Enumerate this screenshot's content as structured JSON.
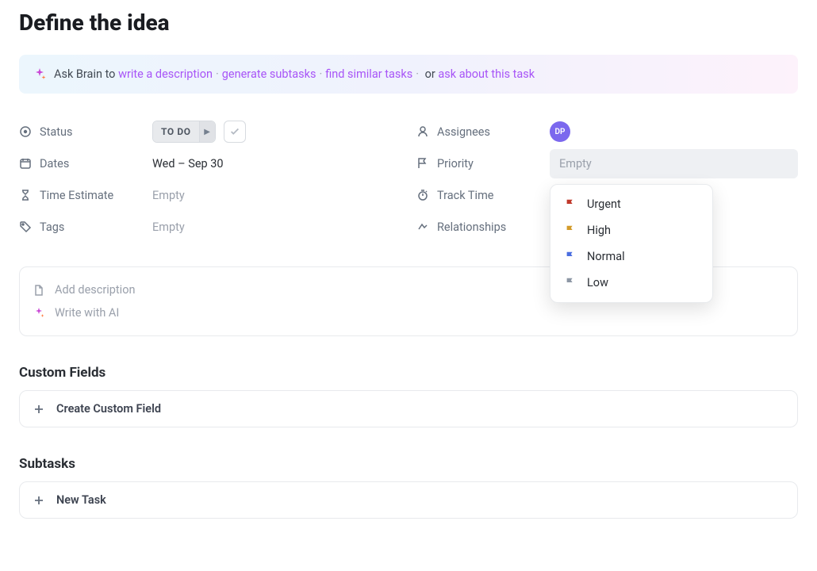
{
  "title": "Define the idea",
  "ai_banner": {
    "lead": "Ask Brain to",
    "write_description": "write a description",
    "generate_subtasks": "generate subtasks",
    "find_similar": "find similar tasks",
    "or": "or",
    "ask_about": "ask about this task"
  },
  "fields": {
    "status": {
      "label": "Status",
      "value": "TO DO"
    },
    "dates": {
      "label": "Dates",
      "value": "Wed – Sep 30"
    },
    "time_estimate": {
      "label": "Time Estimate",
      "value": "Empty"
    },
    "tags": {
      "label": "Tags",
      "value": "Empty"
    },
    "assignees": {
      "label": "Assignees",
      "initials": "DP"
    },
    "priority": {
      "label": "Priority",
      "placeholder": "Empty"
    },
    "track_time": {
      "label": "Track Time"
    },
    "relationships": {
      "label": "Relationships"
    }
  },
  "priority_options": [
    {
      "label": "Urgent",
      "color": "#c0392b"
    },
    {
      "label": "High",
      "color": "#d39b2a"
    },
    {
      "label": "Normal",
      "color": "#4a6ee0"
    },
    {
      "label": "Low",
      "color": "#8d97a5"
    }
  ],
  "description_box": {
    "add": "Add description",
    "write_ai": "Write with AI"
  },
  "custom_fields": {
    "heading": "Custom Fields",
    "create": "Create Custom Field"
  },
  "subtasks": {
    "heading": "Subtasks",
    "new": "New Task"
  }
}
